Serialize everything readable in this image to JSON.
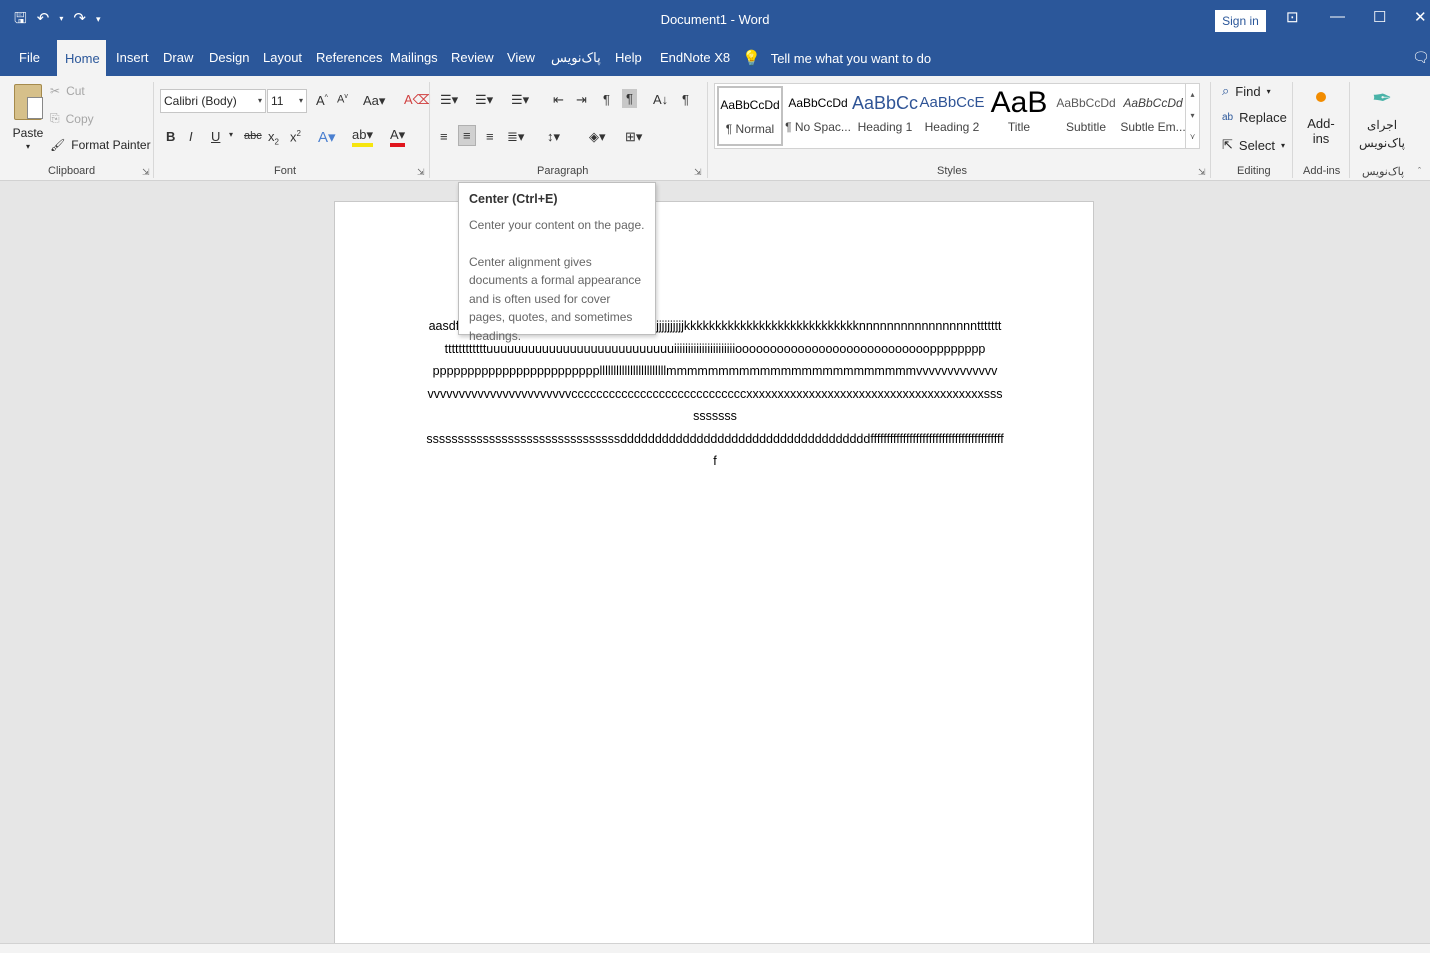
{
  "window": {
    "title": "Document1  -  Word",
    "sign_in": "Sign in"
  },
  "tabs": [
    {
      "label": "File"
    },
    {
      "label": "Home"
    },
    {
      "label": "Insert"
    },
    {
      "label": "Draw"
    },
    {
      "label": "Design"
    },
    {
      "label": "Layout"
    },
    {
      "label": "References"
    },
    {
      "label": "Mailings"
    },
    {
      "label": "Review"
    },
    {
      "label": "View"
    },
    {
      "label": "پاک‌نویس"
    },
    {
      "label": "Help"
    },
    {
      "label": "EndNote X8"
    }
  ],
  "tell_me": "Tell me what you want to do",
  "clipboard": {
    "paste": "Paste",
    "cut": "Cut",
    "copy": "Copy",
    "format_painter": "Format Painter",
    "label": "Clipboard"
  },
  "font": {
    "name": "Calibri (Body)",
    "size": "11",
    "label": "Font"
  },
  "paragraph": {
    "label": "Paragraph"
  },
  "styles": {
    "label": "Styles",
    "items": [
      {
        "sample": "AaBbCcDd",
        "name": "¶ Normal"
      },
      {
        "sample": "AaBbCcDd",
        "name": "¶ No Spac..."
      },
      {
        "sample": "AaBbCc",
        "name": "Heading 1"
      },
      {
        "sample": "AaBbCcE",
        "name": "Heading 2"
      },
      {
        "sample": "AaB",
        "name": "Title"
      },
      {
        "sample": "AaBbCcDd",
        "name": "Subtitle"
      },
      {
        "sample": "AaBbCcDd",
        "name": "Subtle Em..."
      }
    ]
  },
  "editing": {
    "find": "Find",
    "replace": "Replace",
    "select": "Select",
    "label": "Editing"
  },
  "addins": {
    "button": "Add-ins",
    "label": "Add-ins"
  },
  "paknevis": {
    "button_line1": "اجرای",
    "button_line2": "پاک‌نویس",
    "label": "پاک‌نویس"
  },
  "document": {
    "text_start": "aasdfg",
    "lines": [
      "jjjjjjjjjjkkkkkkkkkkkkkkkkkkkkkkkkkkkknnnnnnnnnnnnnnnnnttttttt",
      "ttttttttttttuuuuuuuuuuuuuuuuuuuuuuuuuuuiiiiiiiiiiiiiiiiiiiiiioooooooooooooooooooooooooooopppppppp",
      "ppppppppppppppppppppppppllllllllllllllllllllllllmmmmmmmmmmmmmmmmmmmmmmmmvvvvvvvvvvvvv",
      "vvvvvvvvvvvvvvvvvvvvvvvccccccccccccccccccccccccccccxxxxxxxxxxxxxxxxxxxxxxxxxxxxxxxxxxxxxxssssssssss",
      "sssssssssssssssssssssssssssssssddddddddddddddddddddddddddddddddddddffffffffffffffffffffffffffffffffffffffffff"
    ]
  },
  "tooltip": {
    "title": "Center (Ctrl+E)",
    "line1": "Center your content on the page.",
    "line2": "Center alignment gives documents a formal appearance and is often used for cover pages, quotes, and sometimes headings."
  }
}
